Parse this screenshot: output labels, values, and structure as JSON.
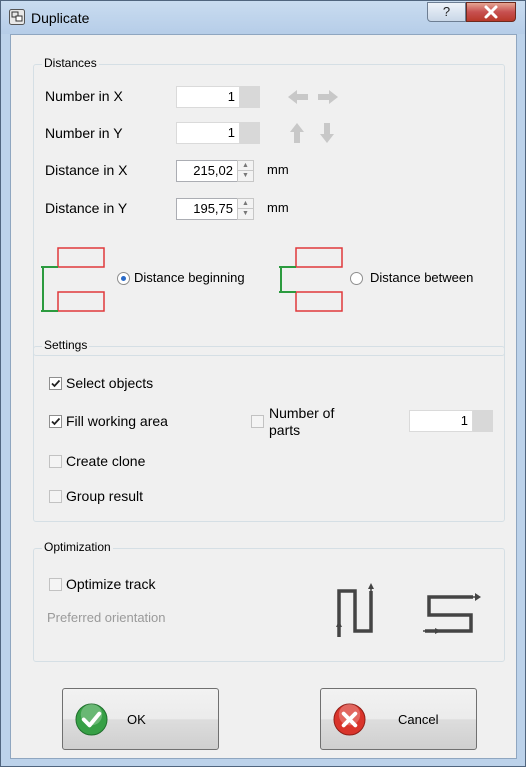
{
  "window": {
    "title": "Duplicate",
    "help_label": "?"
  },
  "distances": {
    "group_label": "Distances",
    "number_in_x": {
      "label": "Number in X",
      "value": "1"
    },
    "number_in_y": {
      "label": "Number in Y",
      "value": "1"
    },
    "distance_in_x": {
      "label": "Distance in X",
      "value": "215,02",
      "unit": "mm"
    },
    "distance_in_y": {
      "label": "Distance in Y",
      "value": "195,75",
      "unit": "mm"
    },
    "mode_beginning": {
      "label": "Distance beginning",
      "selected": true
    },
    "mode_between": {
      "label": "Distance between",
      "selected": false
    }
  },
  "settings": {
    "group_label": "Settings",
    "select_objects": {
      "label": "Select objects",
      "checked": true
    },
    "fill_working_area": {
      "label": "Fill working area",
      "checked": true
    },
    "number_of_parts": {
      "label_line1": "Number of",
      "label_line2": "parts",
      "value": "1",
      "checked": false
    },
    "create_clone": {
      "label": "Create clone",
      "checked": false
    },
    "group_result": {
      "label": "Group result",
      "checked": false
    }
  },
  "optimization": {
    "group_label": "Optimization",
    "optimize_track": {
      "label": "Optimize track",
      "checked": false
    },
    "preferred_orientation": "Preferred orientation"
  },
  "buttons": {
    "ok": "OK",
    "cancel": "Cancel"
  },
  "colors": {
    "accent_red": "#e0383b",
    "accent_green": "#2c9b3f",
    "radio_selected": "#2a6bc9"
  },
  "icons": [
    "app-icon",
    "arrow-left-icon",
    "arrow-right-icon",
    "arrow-up-icon",
    "arrow-down-icon",
    "vertical-orientation-icon",
    "horizontal-orientation-icon",
    "ok-check-icon",
    "cancel-x-icon"
  ]
}
